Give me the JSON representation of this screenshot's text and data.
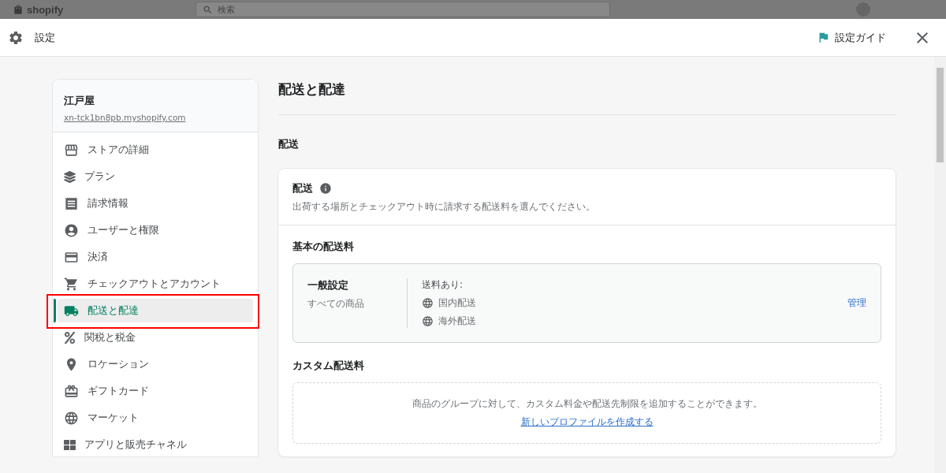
{
  "backdrop": {
    "logo": "shopify",
    "search": {
      "placeholder": "検索"
    }
  },
  "modal": {
    "title": "設定",
    "guide_button": "設定ガイド"
  },
  "sidebar": {
    "store_name": "江戸屋",
    "store_url": "xn-tck1bn8pb.myshopify.com",
    "items": [
      {
        "label": "ストアの詳細",
        "selected": false,
        "highlighted": false
      },
      {
        "label": "プラン",
        "selected": false,
        "highlighted": false
      },
      {
        "label": "請求情報",
        "selected": false,
        "highlighted": false
      },
      {
        "label": "ユーザーと権限",
        "selected": false,
        "highlighted": false
      },
      {
        "label": "決済",
        "selected": false,
        "highlighted": false
      },
      {
        "label": "チェックアウトとアカウント",
        "selected": false,
        "highlighted": false
      },
      {
        "label": "配送と配達",
        "selected": true,
        "highlighted": true
      },
      {
        "label": "関税と税金",
        "selected": false,
        "highlighted": false
      },
      {
        "label": "ロケーション",
        "selected": false,
        "highlighted": false
      },
      {
        "label": "ギフトカード",
        "selected": false,
        "highlighted": false
      },
      {
        "label": "マーケット",
        "selected": false,
        "highlighted": false
      },
      {
        "label": "アプリと販売チャネル",
        "selected": false,
        "highlighted": false
      }
    ]
  },
  "main": {
    "title": "配送と配達",
    "section_title": "配送",
    "card": {
      "title": "配送",
      "description": "出荷する場所とチェックアウト時に請求する配送料を選んでください。",
      "general_rates": {
        "heading": "基本の配送料",
        "profile_name": "一般設定",
        "profile_scope": "すべての商品",
        "rates_label": "送料あり:",
        "zones": [
          "国内配送",
          "海外配送"
        ],
        "manage_link": "管理"
      },
      "custom_rates": {
        "heading": "カスタム配送料",
        "message": "商品のグループに対して、カスタム料金や配送先制限を追加することができます。",
        "create_link": "新しいプロファイルを作成する"
      }
    }
  }
}
